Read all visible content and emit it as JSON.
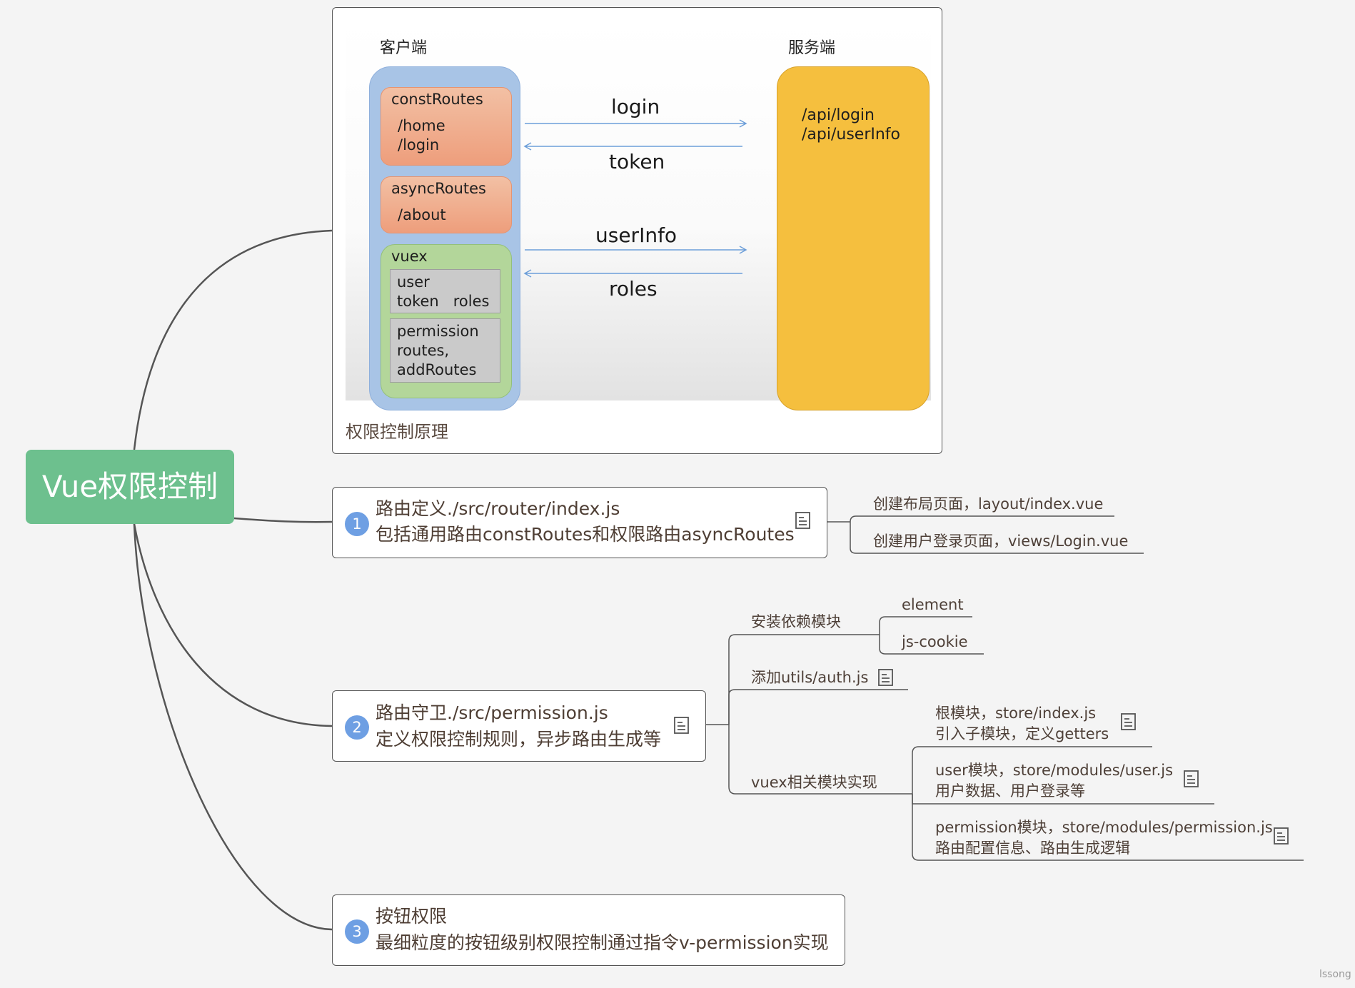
{
  "root": {
    "label": "Vue权限控制"
  },
  "diagram": {
    "caption": "权限控制原理",
    "client": {
      "title": "客户端",
      "const_routes": {
        "title": "constRoutes",
        "items": [
          "/home",
          "/login"
        ]
      },
      "async_routes": {
        "title": "asyncRoutes",
        "items": [
          "/about"
        ]
      },
      "vuex": {
        "title": "vuex",
        "user_module": {
          "line1": "user",
          "line2": "token   roles"
        },
        "permission_module": {
          "line1": "permission",
          "line2": "routes,",
          "line3": "addRoutes"
        }
      }
    },
    "server": {
      "title": "服务端",
      "api1": "/api/login",
      "api2": "/api/userInfo"
    },
    "arrows": {
      "login": "login",
      "token": "token",
      "userinfo": "userInfo",
      "roles": "roles"
    }
  },
  "topics": [
    {
      "number": "1",
      "line1": "路由定义./src/router/index.js",
      "line2": "包括通用路由constRoutes和权限路由asyncRoutes",
      "note_icon": "note-icon",
      "children": [
        "创建布局页面，layout/index.vue",
        "创建用户登录页面，views/Login.vue"
      ]
    },
    {
      "number": "2",
      "line1": "路由守卫./src/permission.js",
      "line2": "定义权限控制规则，异步路由生成等",
      "note_icon": "note-icon",
      "children": {
        "install": {
          "label": "安装依赖模块",
          "items": [
            "element",
            "js-cookie"
          ]
        },
        "auth": {
          "label": "添加utils/auth.js"
        },
        "vuex": {
          "label": "vuex相关模块实现",
          "items": [
            {
              "line1": "根模块，store/index.js",
              "line2": "引入子模块，定义getters"
            },
            {
              "line1": "user模块，store/modules/user.js",
              "line2": "用户数据、用户登录等"
            },
            {
              "line1": "permission模块，store/modules/permission.js",
              "line2": "路由配置信息、路由生成逻辑"
            }
          ]
        }
      }
    },
    {
      "number": "3",
      "line1": "按钮权限",
      "line2": "最细粒度的按钮级别权限控制通过指令v-permission实现"
    }
  ],
  "watermark": "lssong",
  "colors": {
    "root": "#6dc08e",
    "client": "#a8c4e6",
    "server": "#f5bf3e",
    "routes": "#ee9e7c",
    "vuex": "#b3d69a",
    "number_badge": "#6e9fe3",
    "arrow": "#6d9fd9"
  }
}
